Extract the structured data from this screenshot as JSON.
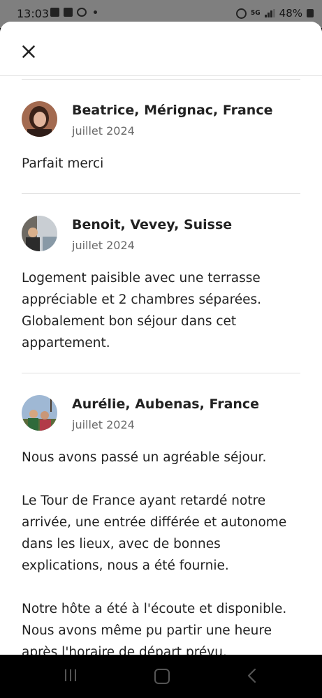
{
  "status_bar": {
    "time": "13:03",
    "battery": "48%",
    "network": "5G"
  },
  "icons": {
    "close": "close-icon",
    "gallery": "gallery-icon",
    "calendar": "calendar-icon",
    "message": "message-icon",
    "alarm": "alarm-icon",
    "signal": "signal-icon",
    "battery": "battery-icon",
    "recent_apps": "recent-apps-icon",
    "home": "home-icon",
    "back": "back-icon"
  },
  "reviews": [
    {
      "name": "Beatrice, Mérignac, France",
      "date": "juillet 2024",
      "paragraphs": [
        "Parfait merci"
      ]
    },
    {
      "name": "Benoit, Vevey, Suisse",
      "date": "juillet 2024",
      "paragraphs": [
        "Logement paisible avec une terrasse appréciable et 2 chambres séparées. Globalement bon séjour dans cet appartement."
      ]
    },
    {
      "name": "Aurélie, Aubenas, France",
      "date": "juillet 2024",
      "paragraphs": [
        "Nous avons passé un agréable séjour.",
        "Le Tour de France ayant retardé notre arrivée, une entrée différée et autonome dans les lieux, avec de bonnes explications, nous a été fournie.",
        "Notre hôte a été à l'écoute et disponible. Nous avons même pu partir une heure après l'horaire de départ prévu."
      ]
    }
  ]
}
